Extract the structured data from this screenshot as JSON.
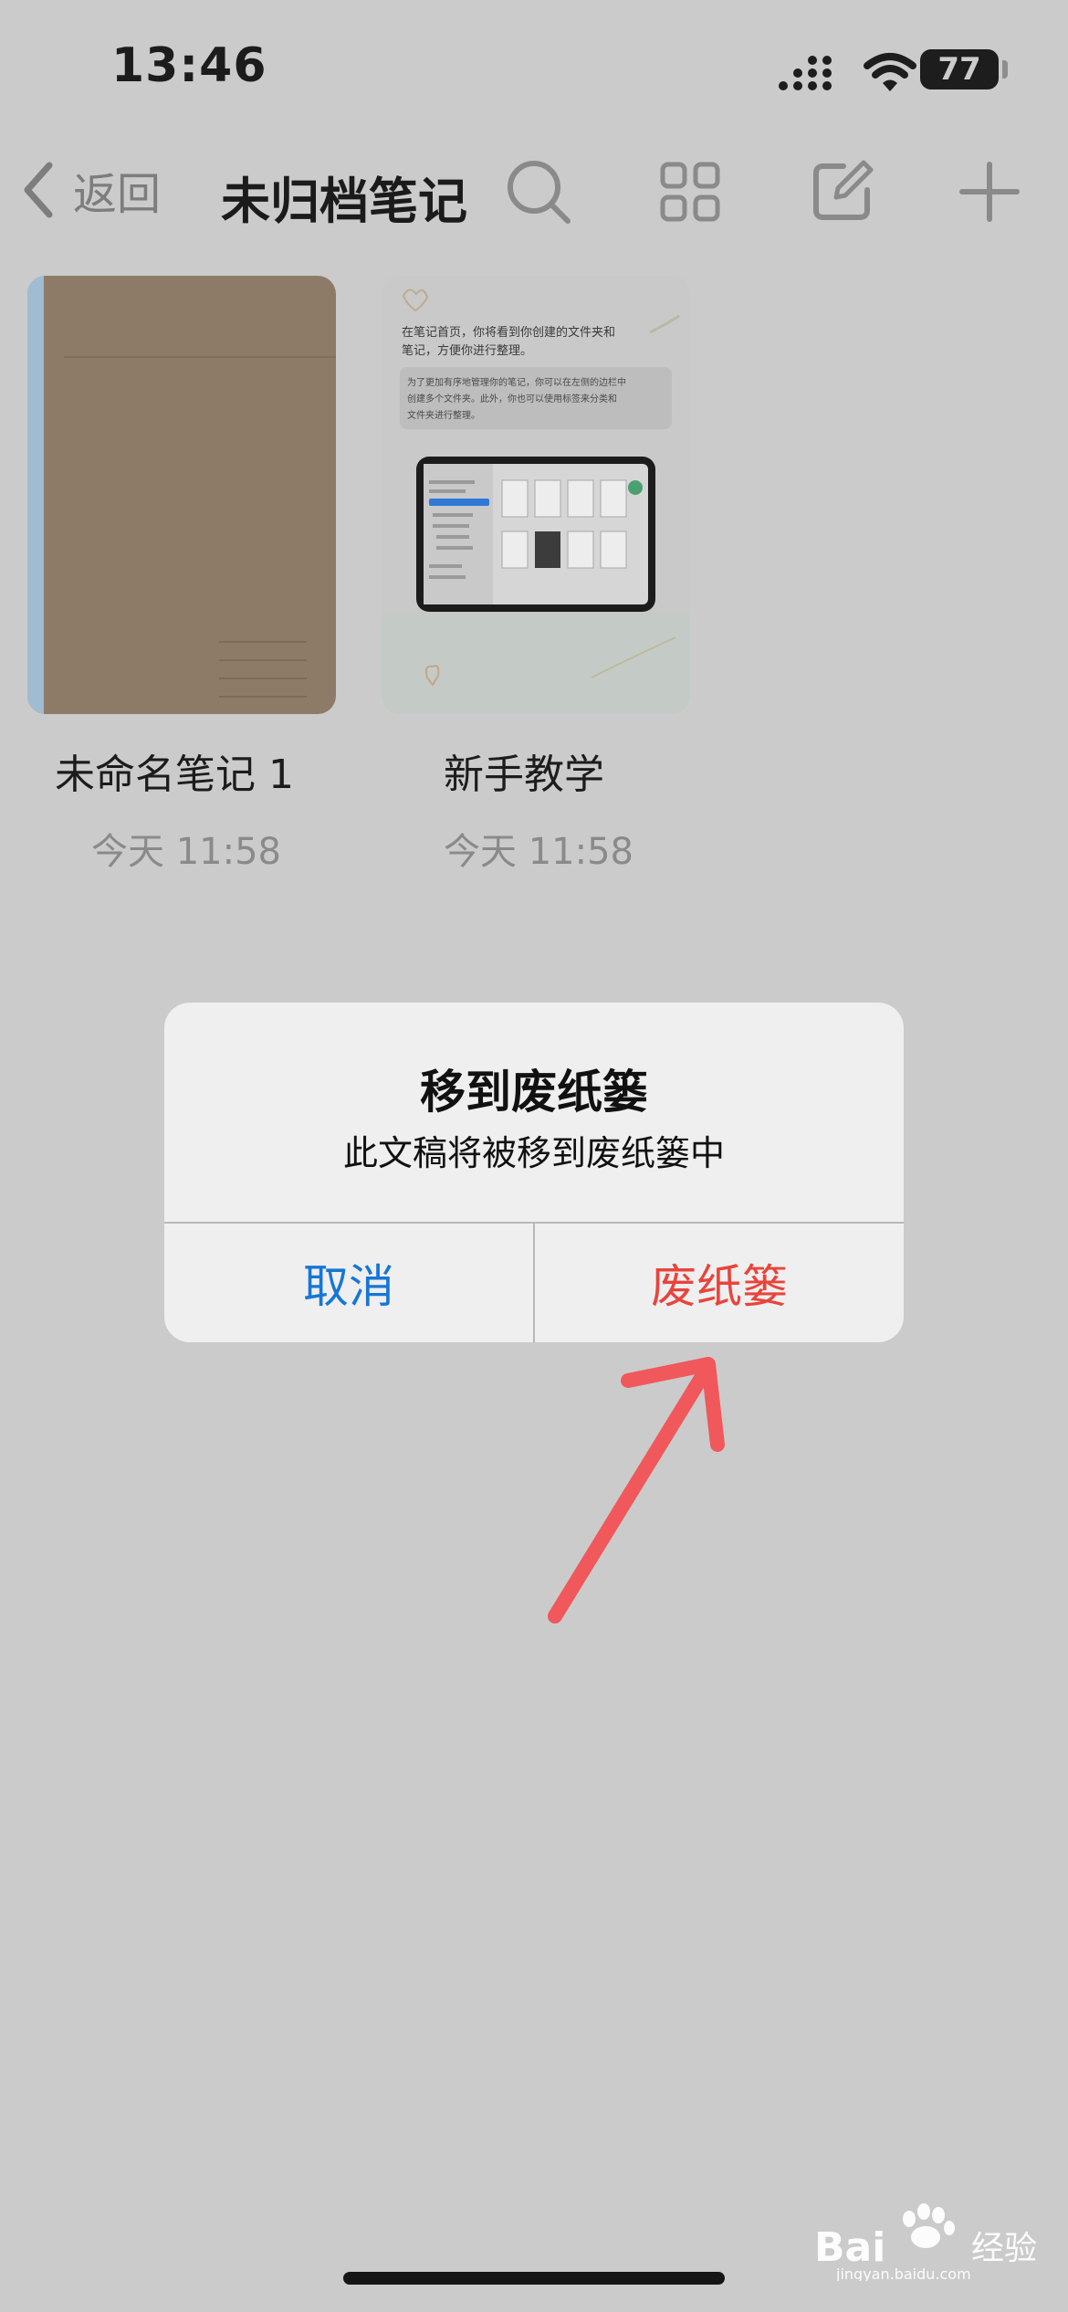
{
  "status_bar": {
    "time": "13:46",
    "battery": "77"
  },
  "nav": {
    "back_label": "返回",
    "title": "未归档笔记"
  },
  "notes": [
    {
      "title": "未命名笔记 1",
      "date": "今天 11:58"
    },
    {
      "title": "新手教学",
      "date": "今天 11:58"
    }
  ],
  "tutorial_cover": {
    "line1": "在笔记首页，你将看到你创建的文件夹和",
    "line2": "笔记，方便你进行整理。",
    "box1": "为了更加有序地管理你的笔记，你可以在左侧的边栏中",
    "box2": "创建多个文件夹。此外，你也可以使用标签来分类和",
    "box3": "文件夹进行整理。"
  },
  "alert": {
    "title": "移到废纸篓",
    "message": "此文稿将被移到废纸篓中",
    "cancel_label": "取消",
    "confirm_label": "废纸篓"
  },
  "watermark": {
    "brand": "Bai",
    "brand2": "经验",
    "url": "jingyan.baidu.com"
  },
  "colors": {
    "background": "#cbcbcb",
    "cancel": "#1676d6",
    "destructive": "#e8443c",
    "arrow": "#f0585b",
    "cover_brown": "#8e7b67",
    "cover_spine": "#9fbcd2"
  }
}
